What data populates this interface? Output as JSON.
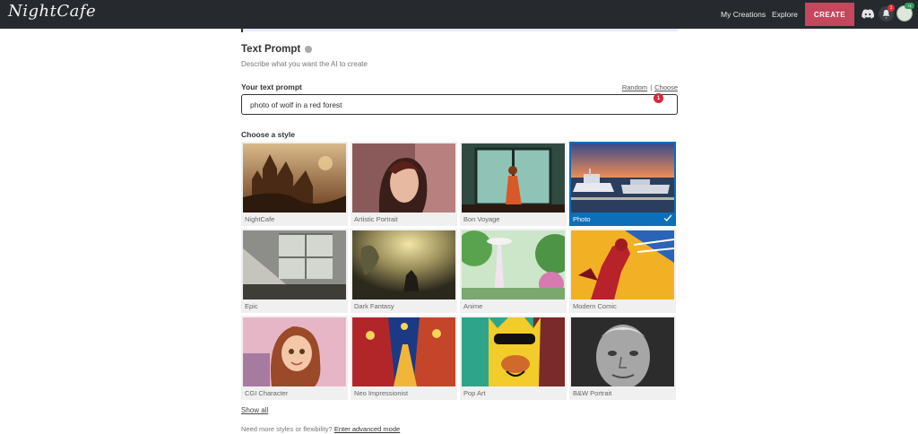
{
  "header": {
    "logo_text": "NightCafe",
    "nav": {
      "my_creations": "My Creations",
      "explore": "Explore"
    },
    "create_label": "CREATE",
    "notification_count": "1",
    "avatar_badge": "+1"
  },
  "text_prompt": {
    "title": "Text Prompt",
    "description": "Describe what you want the AI to create",
    "label": "Your text prompt",
    "random_label": "Random",
    "separator": "|",
    "choose_label": "Choose",
    "value": "photo of wolf in a red forest",
    "error_count": "1"
  },
  "styles": {
    "label": "Choose a style",
    "items": [
      {
        "name": "NightCafe",
        "selected": false
      },
      {
        "name": "Artistic Portrait",
        "selected": false
      },
      {
        "name": "Bon Voyage",
        "selected": false
      },
      {
        "name": "Photo",
        "selected": true
      },
      {
        "name": "Epic",
        "selected": false
      },
      {
        "name": "Dark Fantasy",
        "selected": false
      },
      {
        "name": "Anime",
        "selected": false
      },
      {
        "name": "Modern Comic",
        "selected": false
      },
      {
        "name": "CGI Character",
        "selected": false
      },
      {
        "name": "Neo Impressionist",
        "selected": false
      },
      {
        "name": "Pop Art",
        "selected": false
      },
      {
        "name": "B&W Portrait",
        "selected": false
      }
    ],
    "show_all_label": "Show all"
  },
  "footer": {
    "more_styles_text": "Need more styles or flexibility?",
    "advanced_link": "Enter advanced mode"
  },
  "colors": {
    "topbar": "#262a2e",
    "create_button": "#c5475e",
    "selected_style": "#0c6fb8",
    "error_badge": "#d6263a"
  }
}
